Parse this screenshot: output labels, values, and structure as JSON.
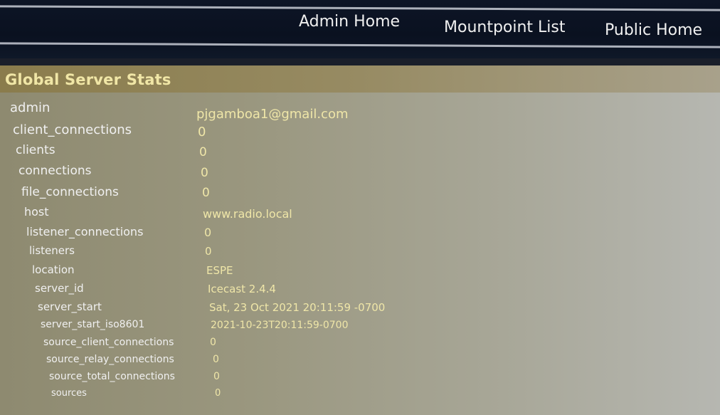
{
  "nav": {
    "admin_home": "Admin Home",
    "mountpoint_list": "Mountpoint List",
    "public_home": "Public Home"
  },
  "panel": {
    "title": "Global Server Stats"
  },
  "stats": [
    {
      "key": "admin",
      "value": "pjgamboa1@gmail.com"
    },
    {
      "key": "client_connections",
      "value": "0"
    },
    {
      "key": "clients",
      "value": "0"
    },
    {
      "key": "connections",
      "value": "0"
    },
    {
      "key": "file_connections",
      "value": "0"
    },
    {
      "key": "host",
      "value": "www.radio.local"
    },
    {
      "key": "listener_connections",
      "value": "0"
    },
    {
      "key": "listeners",
      "value": "0"
    },
    {
      "key": "location",
      "value": "ESPE"
    },
    {
      "key": "server_id",
      "value": "Icecast 2.4.4"
    },
    {
      "key": "server_start",
      "value": "Sat, 23 Oct 2021 20:11:59 -0700"
    },
    {
      "key": "server_start_iso8601",
      "value": "2021-10-23T20:11:59-0700"
    },
    {
      "key": "source_client_connections",
      "value": "0"
    },
    {
      "key": "source_relay_connections",
      "value": "0"
    },
    {
      "key": "source_total_connections",
      "value": "0"
    },
    {
      "key": "sources",
      "value": "0"
    }
  ],
  "colors": {
    "header_bg": "#0b1322",
    "panel_bg": "#9a977f",
    "title_text": "#f0e6a6",
    "key_text": "#f0f0f0",
    "value_text": "#efe6a8"
  }
}
